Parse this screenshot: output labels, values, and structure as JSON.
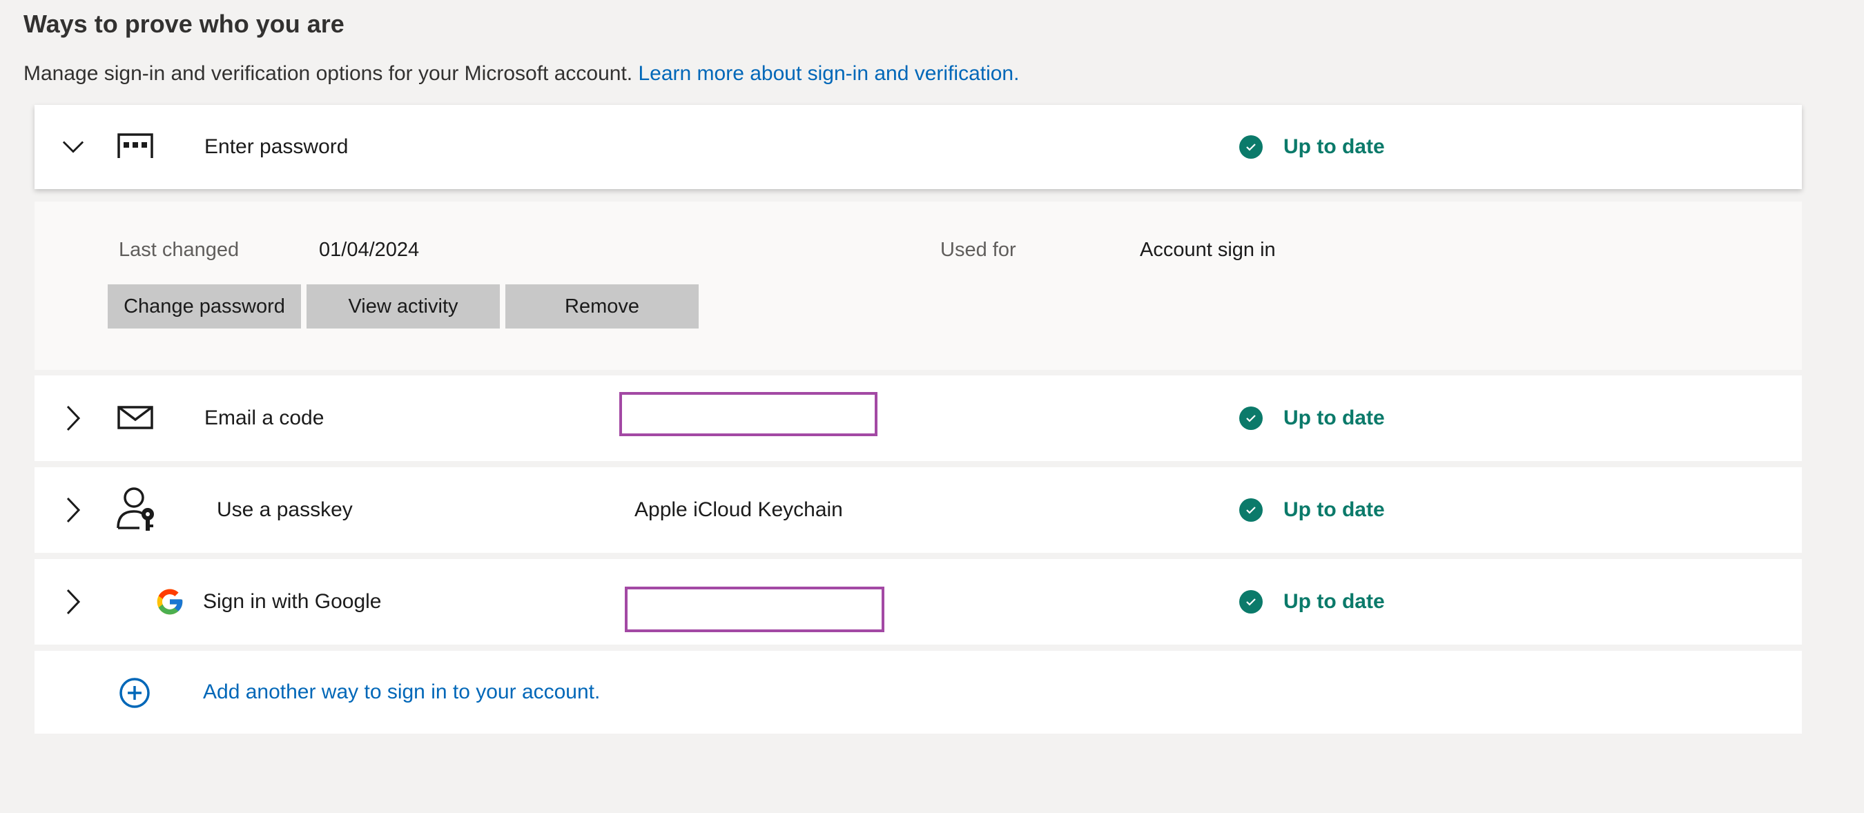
{
  "header": {
    "title": "Ways to prove who you are",
    "description": "Manage sign-in and verification options for your Microsoft account.",
    "learn_more_link": "Learn more about sign-in and verification."
  },
  "methods": {
    "password": {
      "label": "Enter password",
      "status": "Up to date",
      "expanded": true,
      "details": {
        "last_changed_label": "Last changed",
        "last_changed_value": "01/04/2024",
        "used_for_label": "Used for",
        "used_for_value": "Account sign in"
      },
      "buttons": {
        "change_password": "Change password",
        "view_activity": "View activity",
        "remove": "Remove"
      }
    },
    "email": {
      "label": "Email a code",
      "value": "",
      "status": "Up to date"
    },
    "passkey": {
      "label": "Use a passkey",
      "value": "Apple iCloud Keychain",
      "status": "Up to date"
    },
    "google": {
      "label": "Sign in with Google",
      "value": "",
      "status": "Up to date"
    }
  },
  "add_method": {
    "label": "Add another way to sign in to your account."
  },
  "colors": {
    "accent_link": "#0067b8",
    "status_green": "#0b7a6a",
    "redaction_border": "#a349a4",
    "button_bg": "#c8c8c8",
    "page_bg": "#f3f2f1"
  },
  "icons": {
    "password": "password-dots-icon",
    "email": "envelope-icon",
    "passkey": "person-key-icon",
    "google": "google-g-icon",
    "status": "check-circle-icon",
    "add": "plus-circle-icon",
    "expanded_chevron": "chevron-down-icon",
    "collapsed_chevron": "chevron-right-icon"
  }
}
